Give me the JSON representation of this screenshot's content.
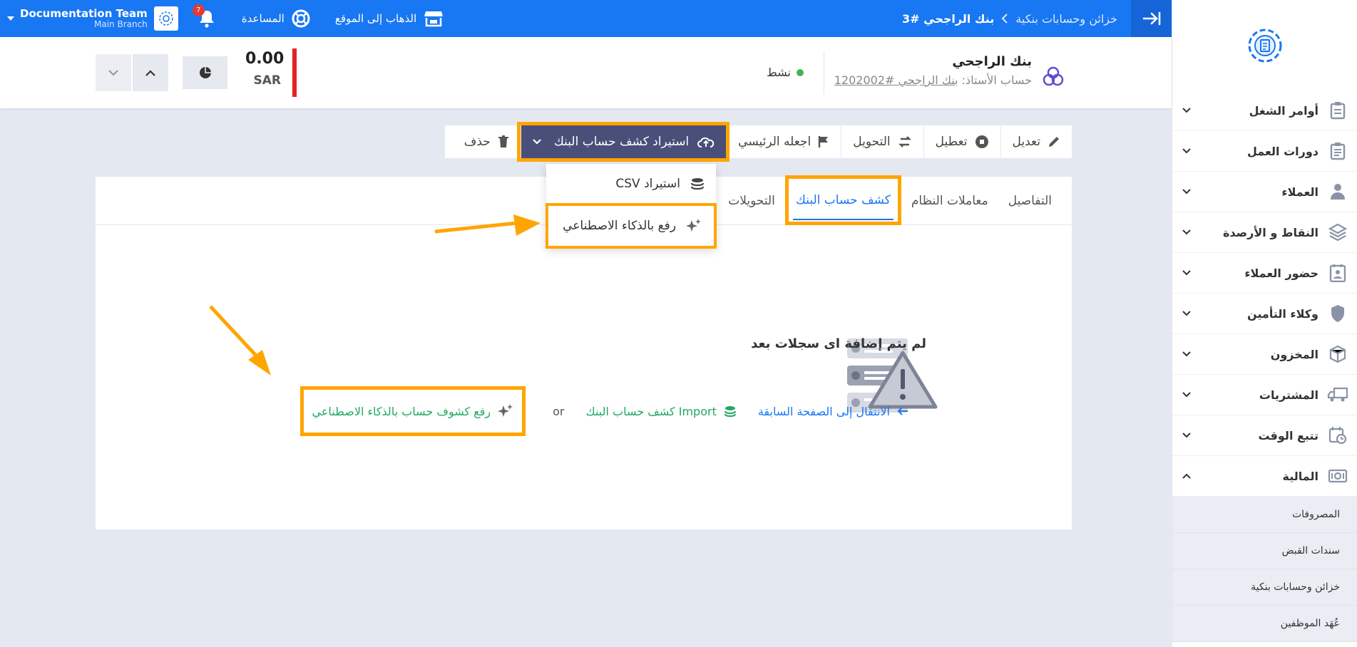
{
  "colors": {
    "primary": "#1877f2",
    "highlight": "#ffa500",
    "import_btn": "#4a4f79",
    "success": "#22a861",
    "danger": "#e32226"
  },
  "topbar": {
    "breadcrumb": {
      "parent": "خزائن وحسابات بنكية",
      "current": "بنك الراجحي #3"
    },
    "go_to_site": "الذهاب إلى الموقع",
    "help": "المساعدة",
    "notifications_count": "7",
    "branch": {
      "team": "Documentation Team",
      "name": "Main Branch"
    }
  },
  "header": {
    "bank_name": "بنك الراجحي",
    "ledger_label": "حساب الأستاذ:",
    "ledger_link": "بنك الراجحي #1202002",
    "status": "نشط",
    "balance": "0.00",
    "currency": "SAR"
  },
  "toolbar": {
    "edit": "تعديل",
    "disable": "تعطيل",
    "transfer": "التحويل",
    "make_primary": "اجعله الرئيسي",
    "import_statement": "استيراد كشف حساب البنك",
    "delete": "حذف"
  },
  "dropdown": {
    "csv": "استيراد CSV",
    "ai_upload": "رفع بالذكاء الاصطناعي"
  },
  "tabs": [
    "التفاصيل",
    "معاملات النظام",
    "كشف حساب البنك",
    "التحويلات"
  ],
  "active_tab": "كشف حساب البنك",
  "empty_state": {
    "title": "لم يتم إضافة اى سجلات بعد",
    "back_link": "الانتقال إلى الصفحة السابقة",
    "import_link": "Import كشف حساب البنك",
    "or": "or",
    "ai_link": "رفع كشوف حساب بالذكاء الاصطناعي"
  },
  "sidebar": {
    "items": [
      {
        "label": "أوامر الشغل",
        "icon": "clipboard-icon"
      },
      {
        "label": "دورات العمل",
        "icon": "clipboard-list-icon"
      },
      {
        "label": "العملاء",
        "icon": "user-icon"
      },
      {
        "label": "النقاط و الأرصدة",
        "icon": "layers-icon"
      },
      {
        "label": "حضور العملاء",
        "icon": "contact-card-icon"
      },
      {
        "label": "وكلاء التأمين",
        "icon": "shield-icon"
      },
      {
        "label": "المخزون",
        "icon": "box-icon"
      },
      {
        "label": "المشتريات",
        "icon": "truck-icon"
      },
      {
        "label": "تتبع الوقت",
        "icon": "calendar-clock-icon"
      },
      {
        "label": "المالية",
        "icon": "money-icon"
      }
    ],
    "finance_sub": [
      "المصروفات",
      "سندات القبض",
      "خزائن وحسابات بنكية",
      "عُهَد الموظفين"
    ]
  }
}
